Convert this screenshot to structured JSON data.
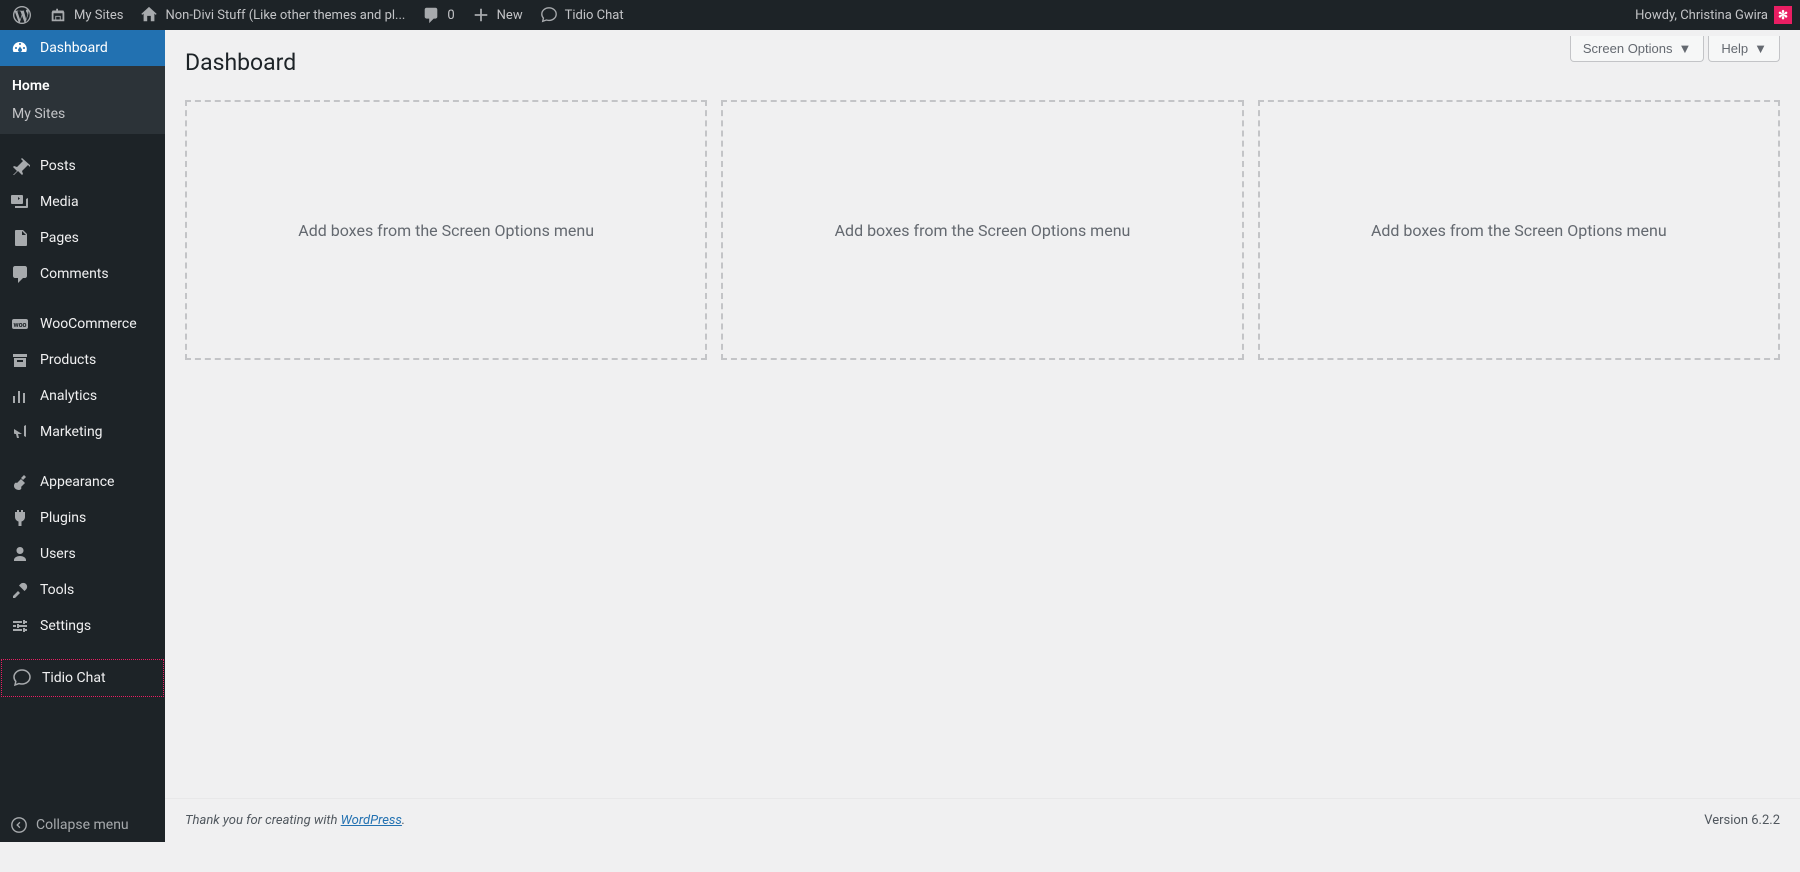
{
  "admin_bar": {
    "my_sites": "My Sites",
    "site_name": "Non-Divi Stuff (Like other themes and pl...",
    "comments_count": "0",
    "new_label": "New",
    "tidio_label": "Tidio Chat",
    "howdy": "Howdy, Christina Gwira",
    "avatar_glyph": "✻"
  },
  "sidebar": {
    "dashboard": "Dashboard",
    "submenu": {
      "home": "Home",
      "my_sites": "My Sites"
    },
    "items": [
      {
        "label": "Posts"
      },
      {
        "label": "Media"
      },
      {
        "label": "Pages"
      },
      {
        "label": "Comments"
      },
      {
        "label": "WooCommerce"
      },
      {
        "label": "Products"
      },
      {
        "label": "Analytics"
      },
      {
        "label": "Marketing"
      },
      {
        "label": "Appearance"
      },
      {
        "label": "Plugins"
      },
      {
        "label": "Users"
      },
      {
        "label": "Tools"
      },
      {
        "label": "Settings"
      },
      {
        "label": "Tidio Chat"
      }
    ],
    "collapse": "Collapse menu"
  },
  "screen_meta": {
    "screen_options": "Screen Options",
    "help": "Help"
  },
  "page": {
    "title": "Dashboard",
    "placeholder_text": "Add boxes from the Screen Options menu"
  },
  "footer": {
    "thank_you_prefix": "Thank you for creating with ",
    "wordpress": "WordPress",
    "period": ".",
    "version": "Version 6.2.2"
  }
}
